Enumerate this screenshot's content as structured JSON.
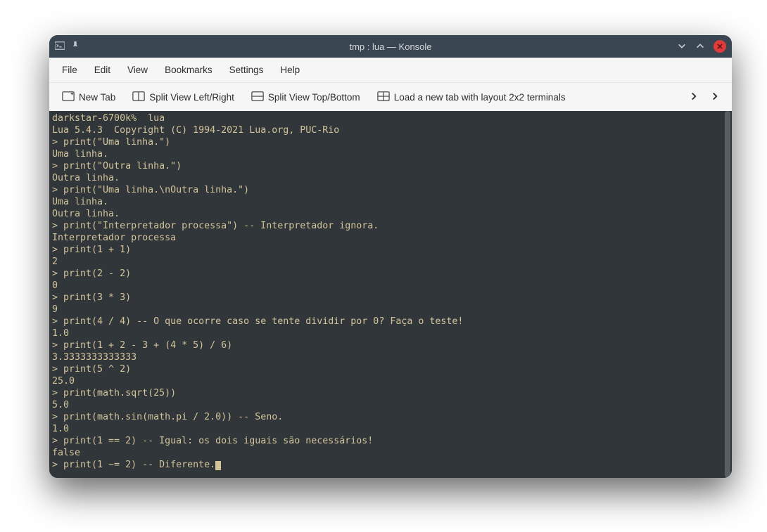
{
  "titlebar": {
    "title": "tmp : lua — Konsole"
  },
  "menubar": {
    "file": "File",
    "edit": "Edit",
    "view": "View",
    "bookmarks": "Bookmarks",
    "settings": "Settings",
    "help": "Help"
  },
  "toolbar": {
    "new_tab": "New Tab",
    "split_lr": "Split View Left/Right",
    "split_tb": "Split View Top/Bottom",
    "layout_2x2": "Load a new tab with layout 2x2 terminals"
  },
  "terminal_lines": [
    "darkstar-6700k%  lua",
    "Lua 5.4.3  Copyright (C) 1994-2021 Lua.org, PUC-Rio",
    "> print(\"Uma linha.\")",
    "Uma linha.",
    "> print(\"Outra linha.\")",
    "Outra linha.",
    "> print(\"Uma linha.\\nOutra linha.\")",
    "Uma linha.",
    "Outra linha.",
    "> print(\"Interpretador processa\") -- Interpretador ignora.",
    "Interpretador processa",
    "> print(1 + 1)",
    "2",
    "> print(2 - 2)",
    "0",
    "> print(3 * 3)",
    "9",
    "> print(4 / 4) -- O que ocorre caso se tente dividir por 0? Faça o teste!",
    "1.0",
    "> print(1 + 2 - 3 + (4 * 5) / 6)",
    "3.3333333333333",
    "> print(5 ^ 2)",
    "25.0",
    "> print(math.sqrt(25))",
    "5.0",
    "> print(math.sin(math.pi / 2.0)) -- Seno.",
    "1.0",
    "> print(1 == 2) -- Igual: os dois iguais são necessários!",
    "false",
    "> print(1 ~= 2) -- Diferente."
  ]
}
